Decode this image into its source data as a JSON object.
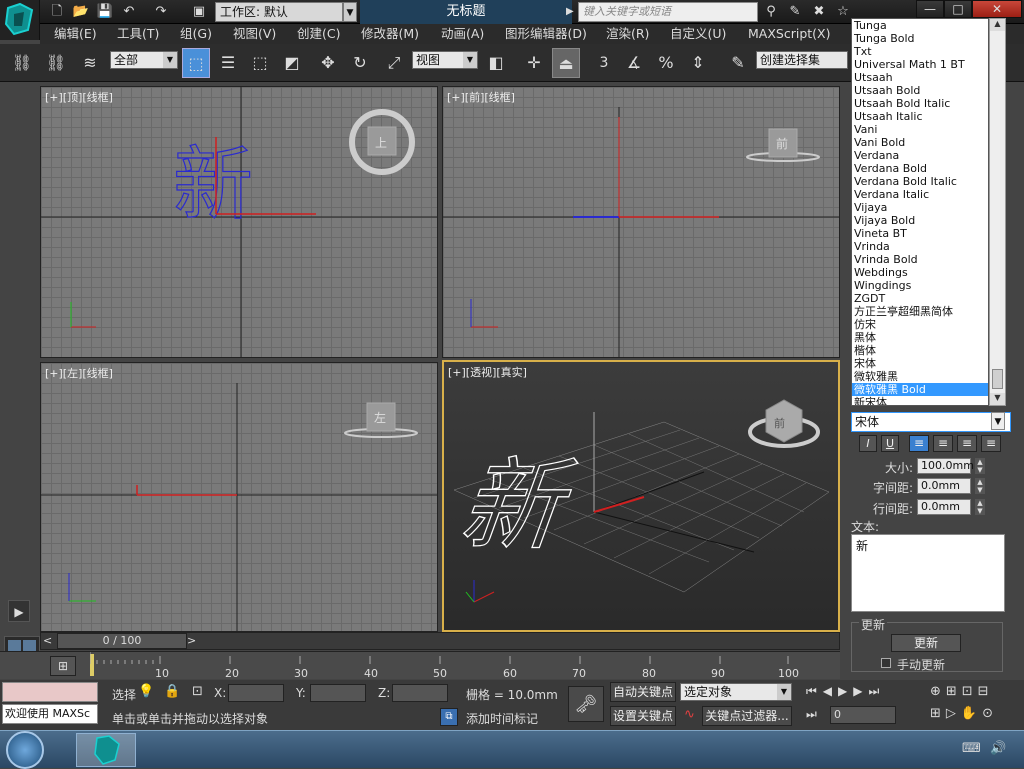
{
  "titlebar": {
    "workspace_label": "工作区: 默认",
    "document_title": "无标题",
    "search_placeholder": "键入关键字或短语",
    "minimize": "—",
    "maximize": "□",
    "close": "✕"
  },
  "menu": [
    "编辑(E)",
    "工具(T)",
    "组(G)",
    "视图(V)",
    "创建(C)",
    "修改器(M)",
    "动画(A)",
    "图形编辑器(D)",
    "渲染(R)",
    "自定义(U)",
    "MAXScript(X)"
  ],
  "toolbar": {
    "selection_filter": "全部",
    "ref_coord": "视图",
    "named_selection": "创建选择集",
    "snap_num": "3",
    "snap_2d": "2",
    "pct": "%"
  },
  "viewports": {
    "top": "[+][顶][线框]",
    "front": "[+][前][线框]",
    "left": "[+][左][线框]",
    "persp": "[+][透视][真实]",
    "cube_top": "上",
    "cube_front": "前",
    "cube_left": "左",
    "text_char": "新"
  },
  "fontlist": {
    "items": [
      "Tunga",
      "Tunga Bold",
      "Txt",
      "Universal Math 1 BT",
      "Utsaah",
      "Utsaah Bold",
      "Utsaah Bold Italic",
      "Utsaah Italic",
      "Vani",
      "Vani Bold",
      "Verdana",
      "Verdana Bold",
      "Verdana Bold Italic",
      "Verdana Italic",
      "Vijaya",
      "Vijaya Bold",
      "Vineta BT",
      "Vrinda",
      "Vrinda Bold",
      "Webdings",
      "Wingdings",
      "ZGDT",
      "方正兰亭超细黑简体",
      "仿宋",
      "黑体",
      "楷体",
      "宋体",
      "微软雅黑",
      "微软雅黑 Bold",
      "新宋体"
    ],
    "selected_index": 28
  },
  "panel": {
    "font_value": "宋体",
    "italic": "I",
    "underline": "U",
    "size_label": "大小:",
    "size_value": "100.0mm",
    "kerning_label": "字间距:",
    "kerning_value": "0.0mm",
    "leading_label": "行间距:",
    "leading_value": "0.0mm",
    "text_label": "文本:",
    "text_value": "新",
    "update_group": "更新",
    "update_button": "更新",
    "manual_update": "手动更新"
  },
  "timeline": {
    "frame": "0 / 100",
    "ticks": [
      "10",
      "20",
      "30",
      "40",
      "50",
      "60",
      "70",
      "80",
      "90",
      "100"
    ],
    "prev": "<",
    "next": ">"
  },
  "status": {
    "welcome": "欢迎使用 MAXSc",
    "selected_label": "选择",
    "x_label": "X:",
    "y_label": "Y:",
    "z_label": "Z:",
    "grid": "栅格 = 10.0mm",
    "hint": "单击或单击并拖动以选择对象",
    "add_time_tag": "添加时间标记",
    "auto_key": "自动关键点",
    "set_key": "设置关键点",
    "key_mode": "选定对象",
    "key_filters": "关键点过滤器...",
    "frame_value": "0"
  },
  "colors": {
    "accent": "#3399ff",
    "axis_red": "#e02020",
    "axis_blue": "#3030d0",
    "axis_green": "#20c020",
    "text_blue": "#2a2ad0"
  }
}
